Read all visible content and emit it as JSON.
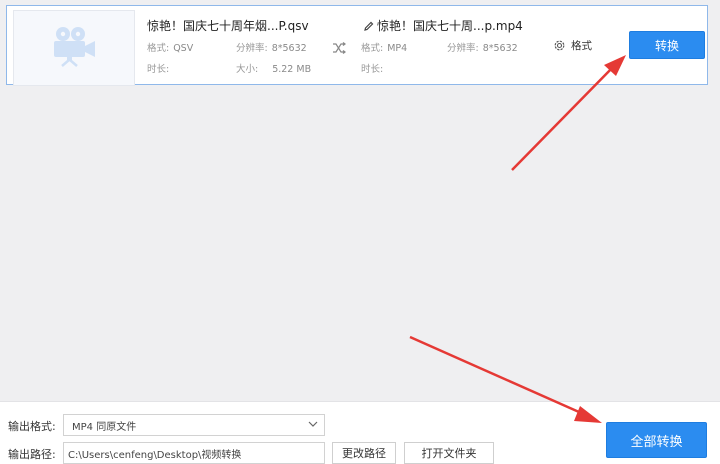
{
  "file": {
    "source_name": "惊艳！国庆七十周年烟...P.qsv",
    "source_format_label": "格式:",
    "source_format": "QSV",
    "source_resolution_label": "分辨率:",
    "source_resolution": "8*5632",
    "source_duration_label": "时长:",
    "source_size_label": "大小:",
    "source_size": "5.22 MB",
    "target_name": "惊艳！国庆七十周...p.mp4",
    "target_format_label": "格式:",
    "target_format": "MP4",
    "target_resolution_label": "分辨率:",
    "target_resolution": "8*5632",
    "target_duration_label": "时长:",
    "format_button": "格式",
    "convert_button": "转换"
  },
  "bottom": {
    "output_format_label": "输出格式:",
    "output_format_value": "MP4  同原文件",
    "output_path_label": "输出路径:",
    "output_path_value": "C:\\Users\\cenfeng\\Desktop\\视频转换",
    "change_path_button": "更改路径",
    "open_folder_button": "打开文件夹",
    "convert_all_button": "全部转换"
  },
  "colors": {
    "accent": "#2b8cf0",
    "annotation_arrow": "#e53935",
    "card_border": "#8fb8ea"
  },
  "icons": [
    "video-camera-icon",
    "shuffle-icon",
    "edit-pencil-icon",
    "gear-icon",
    "chevron-down-icon"
  ]
}
